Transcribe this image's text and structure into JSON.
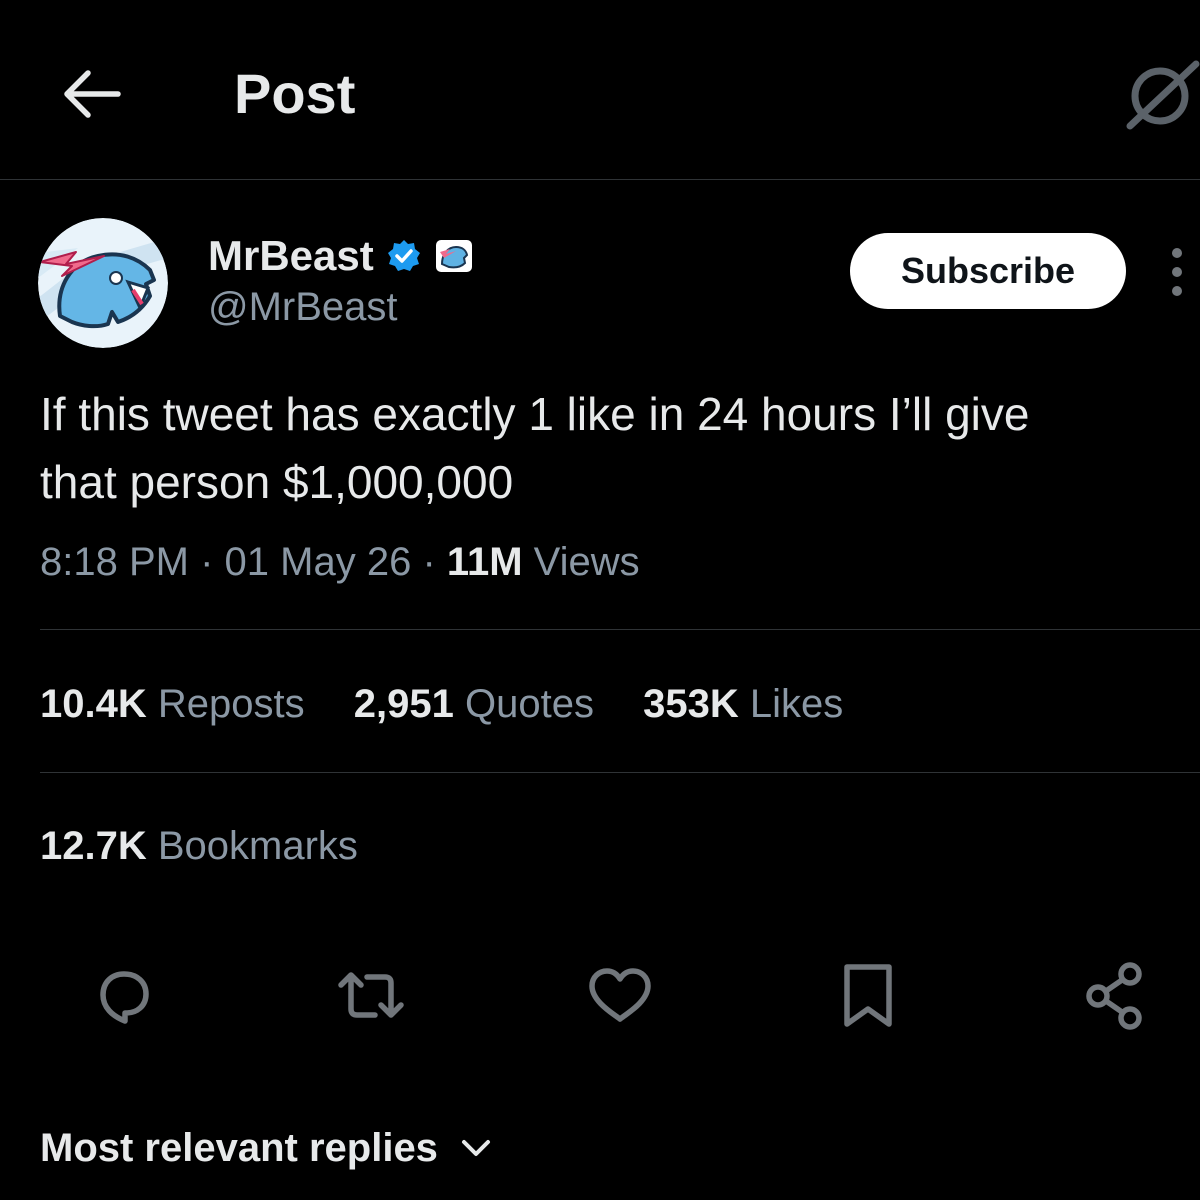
{
  "header": {
    "title": "Post",
    "back_icon": "arrow-left-icon",
    "grok_icon": "grok-icon"
  },
  "author": {
    "display_name": "MrBeast",
    "handle": "@MrBeast",
    "verified_icon": "verified-badge-icon",
    "affiliate_icon": "affiliate-badge-icon",
    "verified_color": "#1d9bf0"
  },
  "subscribe_button": {
    "label": "Subscribe"
  },
  "post": {
    "text_line1": "If this tweet has exactly 1 like in 24 hours I’ll give",
    "text_line2": "that person $1,000,000",
    "time": "8:18 PM",
    "date": "01 May 26",
    "views_count": "11M",
    "views_label": "Views",
    "separator": "·"
  },
  "stats": {
    "reposts_count": "10.4K",
    "reposts_label": "Reposts",
    "quotes_count": "2,951",
    "quotes_label": "Quotes",
    "likes_count": "353K",
    "likes_label": "Likes",
    "bookmarks_count": "12.7K",
    "bookmarks_label": "Bookmarks"
  },
  "actions": [
    "reply-icon",
    "repost-icon",
    "like-icon",
    "bookmark-icon",
    "share-icon"
  ],
  "replies": {
    "sort_label": "Most relevant replies",
    "sort_icon": "chevron-down-icon"
  },
  "colors": {
    "background": "#000000",
    "text": "#e7e9ea",
    "secondary": "#8b98a5",
    "divider": "#2f3336"
  }
}
